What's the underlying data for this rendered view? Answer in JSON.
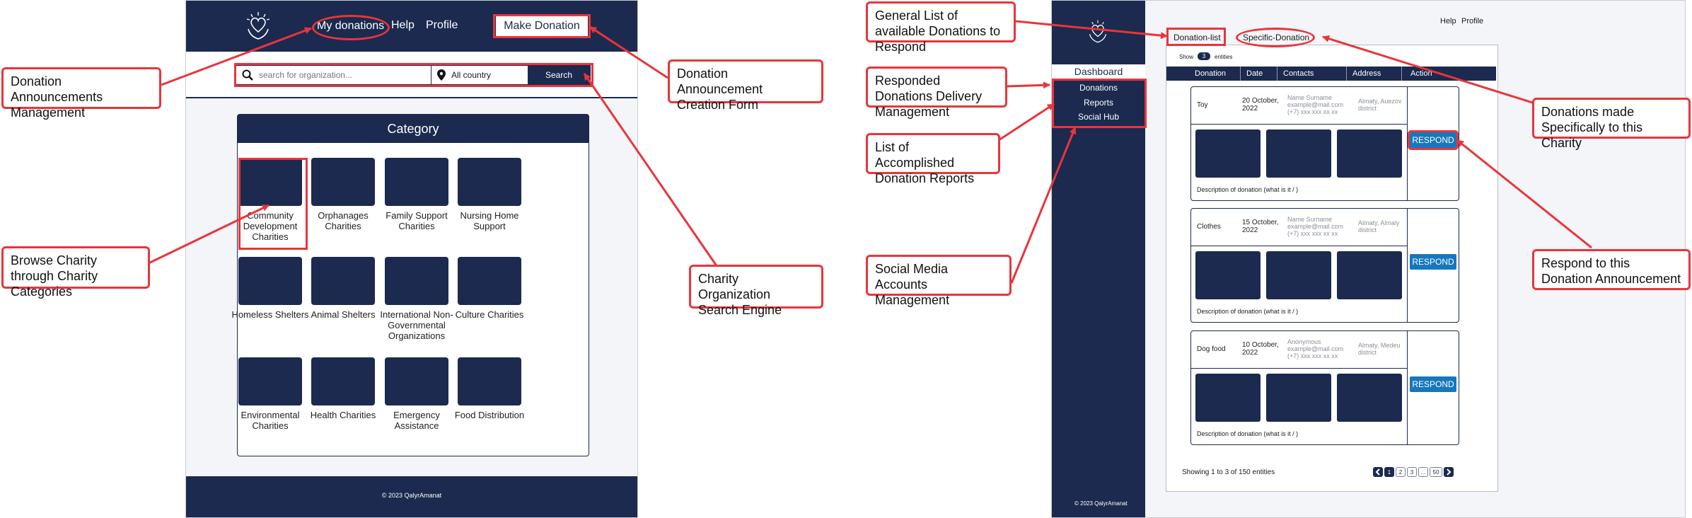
{
  "left": {
    "header": {
      "my_donations": "My donations",
      "help": "Help",
      "profile": "Profile",
      "make_donation": "Make Donation"
    },
    "search": {
      "placeholder": "search for organization...",
      "country": "All country",
      "button": "Search"
    },
    "category": {
      "title": "Category",
      "items": [
        "Community Development Charities",
        "Orphanages Charities",
        "Family Support Charities",
        "Nursing Home Support",
        "Homeless Shelters",
        "Animal Shelters",
        "International Non-Governmental Organizations",
        "Culture Charities",
        "Environmental Charities",
        "Health Charities",
        "Emergency Assistance",
        "Food Distribution"
      ]
    },
    "footer": "© 2023 QalyrAmanat"
  },
  "right": {
    "header": {
      "help": "Help",
      "profile": "Profile"
    },
    "tabs": [
      "Donation-list",
      "Specific-Donation"
    ],
    "sidebar": {
      "title": "Dashboard",
      "items": [
        "Donations",
        "Reports",
        "Social Hub"
      ],
      "footer": "© 2023 QalyrAmanat"
    },
    "show": {
      "label": "Show",
      "value": "3",
      "suffix": "entities"
    },
    "columns": [
      "Donation",
      "Date",
      "Contacts",
      "Address",
      "Action"
    ],
    "rows": [
      {
        "item": "Toy",
        "date": "20 October, 2022",
        "contact_name": "Name Surname",
        "contact_email": "example@mail.com",
        "contact_phone": "(+7) xxx xxx xx xx",
        "address": "Almaty, Auezov district",
        "description": "Description of donation (what is it / )",
        "action": "RESPOND"
      },
      {
        "item": "Clothes",
        "date": "15 October, 2022",
        "contact_name": "Name Surname",
        "contact_email": "example@mail.com",
        "contact_phone": "(+7) xxx xxx xx xx",
        "address": "Almaty, Almaly district",
        "description": "Description of donation (what is it / )",
        "action": "RESPOND"
      },
      {
        "item": "Dog food",
        "date": "10 October, 2022",
        "contact_name": "Anonymous",
        "contact_email": "example@mail.com",
        "contact_phone": "(+7) xxx xxx xx xx",
        "address": "Almaty, Medeu district",
        "description": "Description of donation (what is it / )",
        "action": "RESPOND"
      }
    ],
    "pagination": {
      "summary": "Showing 1 to 3 of 150 entities",
      "prev": "<",
      "pages": [
        "1",
        "2",
        "3",
        "...",
        "50"
      ],
      "next": ">"
    }
  },
  "annotations": {
    "donation_management": "Donation Announcements Management",
    "creation_form": "Donation Announcement Creation Form",
    "browse_categories": "Browse Charity through Charity Categories",
    "search_engine": "Charity Organization Search Engine",
    "general_list": "General List of available Donations to Respond",
    "delivery_management": "Responded Donations Delivery Management",
    "reports": "List of Accomplished Donation Reports",
    "social_media": "Social Media Accounts Management",
    "specific": "Donations made Specifically to this Charity",
    "respond": "Respond to this Donation Announcement"
  },
  "colors": {
    "navy": "#1b2a4e",
    "annotation_red": "#e8353b",
    "respond_blue": "#1777bd"
  },
  "icons": [
    "charity-logo-icon",
    "search-icon",
    "location-pin-icon",
    "chevron-left-icon",
    "chevron-right-icon"
  ]
}
